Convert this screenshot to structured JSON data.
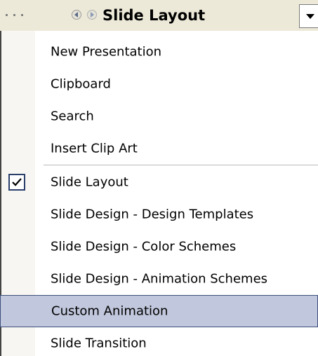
{
  "pane": {
    "title": "Slide Layout"
  },
  "menu": {
    "items": [
      {
        "label": "New Presentation"
      },
      {
        "label": "Clipboard"
      },
      {
        "label": "Search"
      },
      {
        "label": "Insert Clip Art"
      },
      {
        "label": "Slide Layout",
        "checked": true
      },
      {
        "label": "Slide Design - Design Templates"
      },
      {
        "label": "Slide Design - Color Schemes"
      },
      {
        "label": "Slide Design - Animation Schemes"
      },
      {
        "label": "Custom Animation",
        "highlighted": true
      },
      {
        "label": "Slide Transition"
      }
    ]
  },
  "icons": {
    "back": "back-arrow-icon",
    "forward": "forward-arrow-icon",
    "dropdown": "chevron-down-icon",
    "check": "checkmark-icon"
  },
  "colors": {
    "highlight_bg": "#c1c7dc",
    "highlight_border": "#3b4e7a",
    "check_border": "#2b3f6b"
  }
}
